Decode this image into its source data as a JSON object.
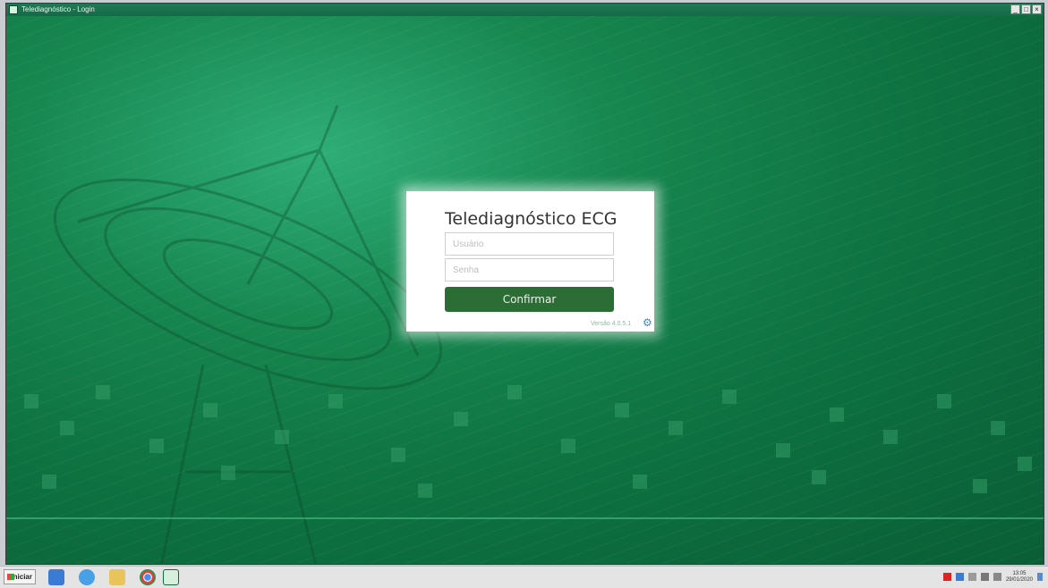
{
  "window": {
    "title": "Telediagnóstico - Login",
    "min_label": "_",
    "max_label": "□",
    "close_label": "×"
  },
  "login": {
    "title": "Telediagnóstico ECG",
    "username_placeholder": "Usuário",
    "password_placeholder": "Senha",
    "confirm_label": "Confirmar",
    "version": "Versão 4.0.5.1"
  },
  "taskbar": {
    "start_label": "Iniciar",
    "clock_time": "13:05",
    "clock_date": "29/01/2020"
  },
  "colors": {
    "background": "#0f7a45",
    "button": "#2b6d34",
    "gear": "#3a86d6"
  }
}
